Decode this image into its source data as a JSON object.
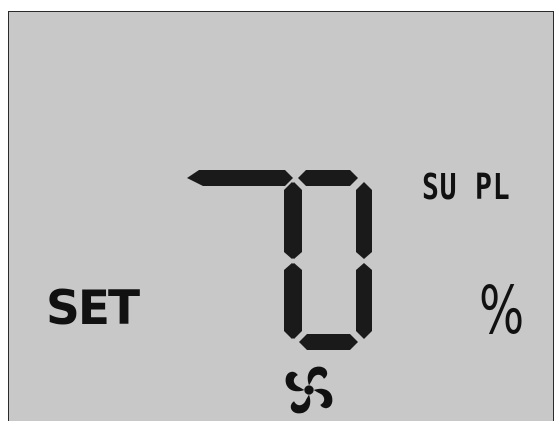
{
  "display": {
    "set_label": "SET",
    "digits": [
      "7",
      "0"
    ],
    "mode_label": "SU PL",
    "unit_label": "%"
  },
  "icons": {
    "fan": "fan-icon"
  },
  "colors": {
    "lcd_background": "#c8c8c8",
    "segment": "#1a1a1a"
  }
}
